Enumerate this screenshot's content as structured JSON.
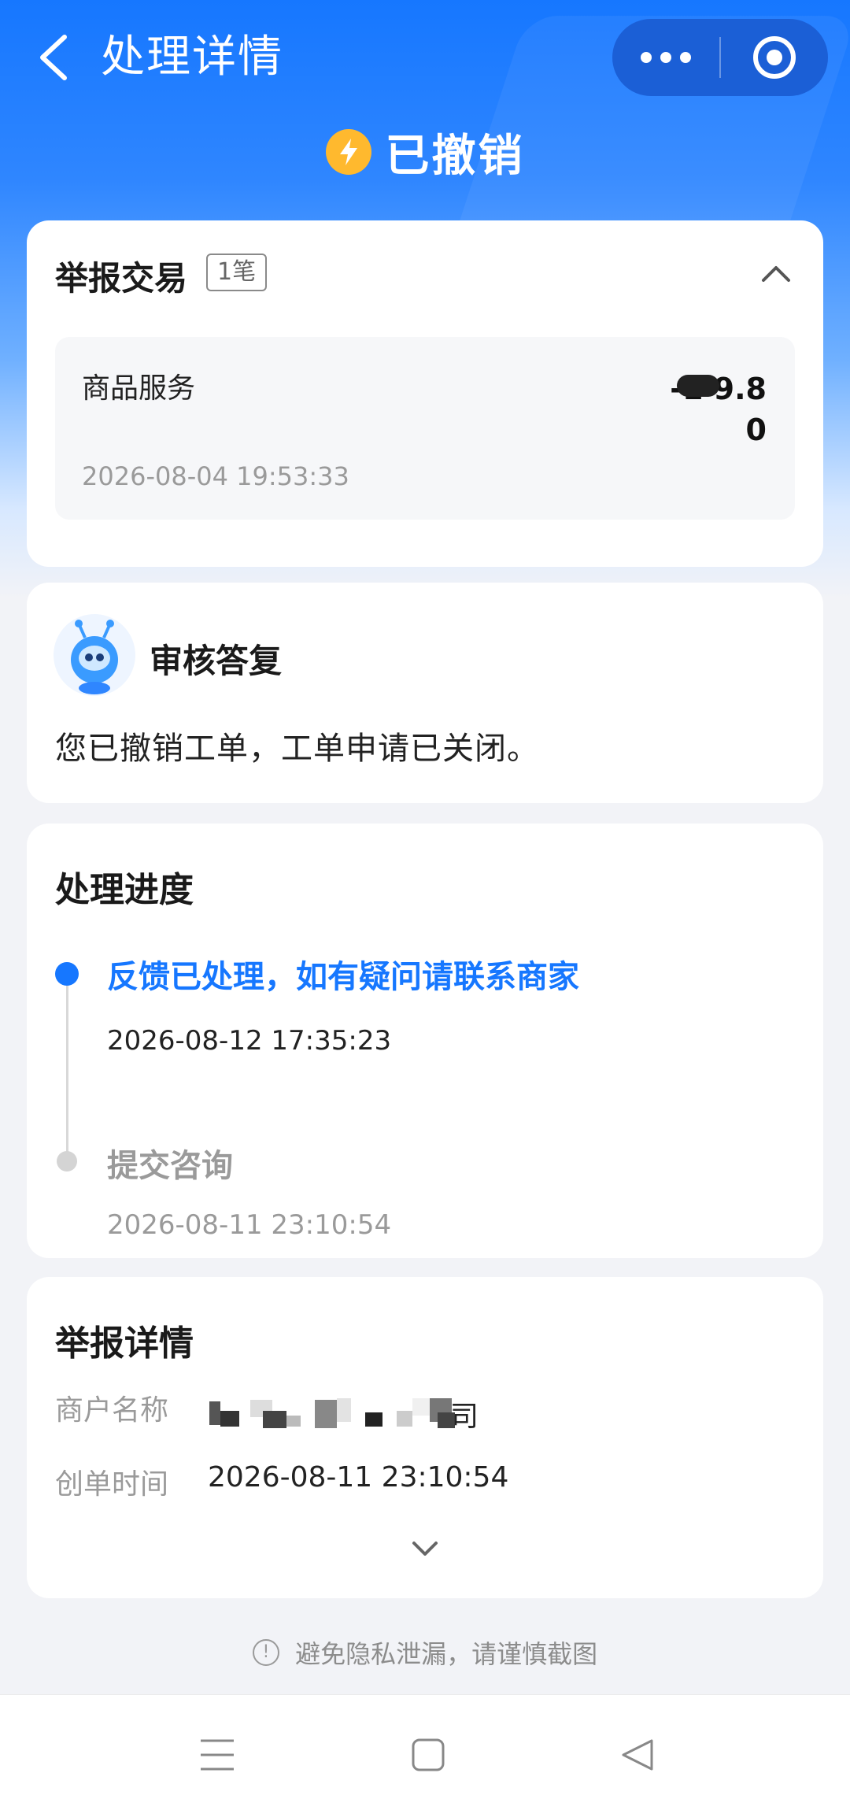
{
  "header": {
    "title": "处理详情"
  },
  "status": {
    "text": "已撤销"
  },
  "report_transaction": {
    "title": "举报交易",
    "count_badge": "1笔",
    "item_name": "商品服务",
    "amount_line1": "-1   9.8",
    "amount_line2": "0",
    "time": "2026-08-04 19:53:33"
  },
  "review_reply": {
    "title": "审核答复",
    "body": "您已撤销工单，工单申请已关闭。"
  },
  "progress": {
    "title": "处理进度",
    "steps": [
      {
        "label": "反馈已处理，如有疑问请联系商家",
        "time": "2026-08-12 17:35:23"
      },
      {
        "label": "提交咨询",
        "time": "2026-08-11 23:10:54"
      }
    ]
  },
  "report_details": {
    "title": "举报详情",
    "merchant_label": "商户名称",
    "merchant_value_tail": "司",
    "created_label": "创单时间",
    "created_value": "2026-08-11 23:10:54"
  },
  "footer": {
    "privacy_notice": "避免隐私泄漏，请谨慎截图"
  },
  "colors": {
    "primary": "#1677ff",
    "status_icon": "#ffb92e"
  }
}
